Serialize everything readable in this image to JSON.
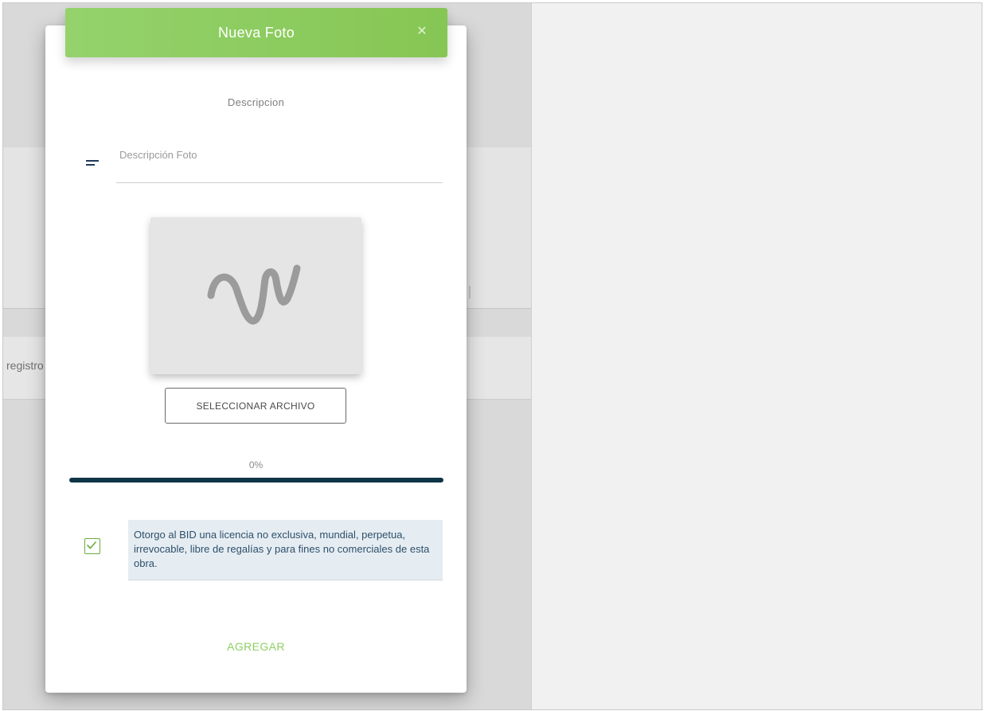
{
  "background": {
    "row_text": "registro"
  },
  "modal": {
    "title": "Nueva Foto",
    "close_icon": "close-icon",
    "section_label": "Descripcion",
    "description_field": {
      "placeholder": "Descripción Foto",
      "value": "",
      "icon": "short-text-icon"
    },
    "preview_icon": "squiggle-image-placeholder-icon",
    "select_file_label": "SELECCIONAR ARCHIVO",
    "progress": {
      "text": "0%",
      "value": 0
    },
    "license": {
      "checked": true,
      "text": "Otorgo al BID una licencia no exclusiva, mundial, perpetua, irrevocable, libre de regalías y para fines no comerciales de esta obra."
    },
    "submit_label": "AGREGAR"
  },
  "colors": {
    "header_green": "#8cc95c",
    "accent_green": "#8fcf62",
    "progress_dark": "#0e3446",
    "license_bg": "#e6edf2",
    "license_text": "#2d4f6b"
  }
}
